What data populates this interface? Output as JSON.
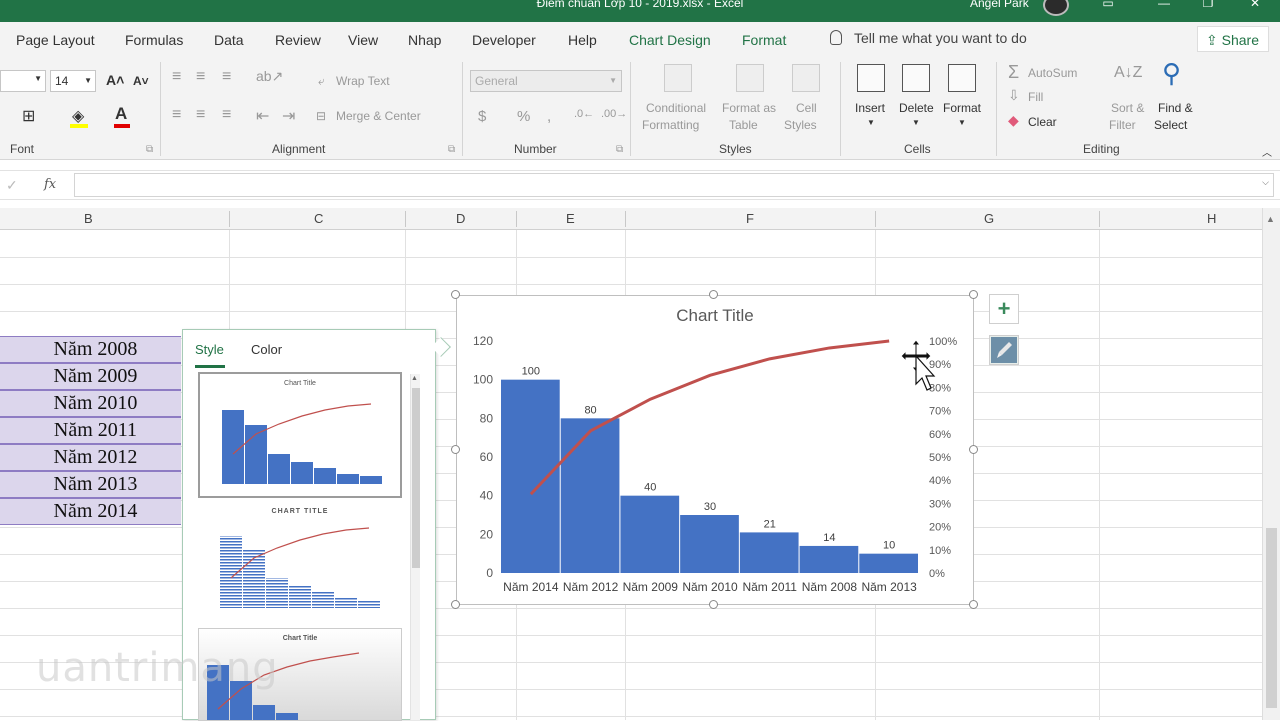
{
  "titlebar": {
    "document": "Điểm chuẩn Lớp 10 - 2019.xlsx  -  Excel",
    "user": "Angel Park"
  },
  "tabs": [
    "Page Layout",
    "Formulas",
    "Data",
    "Review",
    "View",
    "Nhap",
    "Developer",
    "Help",
    "Chart Design",
    "Format"
  ],
  "tell_me": "Tell me what you want to do",
  "share": "Share",
  "ribbon": {
    "font_size": "14",
    "groups": {
      "font": "Font",
      "alignment": "Alignment",
      "number": "Number",
      "styles": "Styles",
      "cells": "Cells",
      "editing": "Editing"
    },
    "wrap_text": "Wrap Text",
    "merge_center": "Merge & Center",
    "number_format": "General",
    "percent": "%",
    "conditional_formatting": [
      "Conditional",
      "Formatting"
    ],
    "format_as_table": [
      "Format as",
      "Table"
    ],
    "cell_styles": [
      "Cell",
      "Styles"
    ],
    "insert": "Insert",
    "delete": "Delete",
    "format": "Format",
    "autosum": "AutoSum",
    "fill": "Fill",
    "clear": "Clear",
    "sort_filter": [
      "Sort &",
      "Filter"
    ],
    "find_select": [
      "Find &",
      "Select"
    ]
  },
  "formula_bar": {
    "fx": "fx",
    "value": ""
  },
  "columns": [
    "B",
    "C",
    "D",
    "E",
    "F",
    "G",
    "H"
  ],
  "year_cells": [
    "Năm 2008",
    "Năm 2009",
    "Năm 2010",
    "Năm 2011",
    "Năm 2012",
    "Năm 2013",
    "Năm 2014"
  ],
  "style_pane": {
    "tabs": [
      "Style",
      "Color"
    ],
    "thumb_titles": [
      "Chart Title",
      "CHART TITLE",
      "Chart Title"
    ]
  },
  "chart_data": {
    "type": "bar",
    "title": "Chart Title",
    "categories": [
      "Năm 2014",
      "Năm 2012",
      "Năm 2009",
      "Năm 2010",
      "Năm 2011",
      "Năm 2008",
      "Năm 2013"
    ],
    "values": [
      100,
      80,
      40,
      30,
      21,
      14,
      10
    ],
    "cumulative_percent": [
      34.0,
      61.3,
      74.9,
      85.2,
      92.3,
      97.0,
      100.0
    ],
    "ylim": [
      0,
      120
    ],
    "yticks": [
      0,
      20,
      40,
      60,
      80,
      100,
      120
    ],
    "y2lim": [
      0,
      100
    ],
    "y2ticks": [
      "0%",
      "10%",
      "20%",
      "30%",
      "40%",
      "50%",
      "60%",
      "70%",
      "80%",
      "90%",
      "100%"
    ],
    "bar_color": "#4472c4",
    "line_color": "#c0504d"
  },
  "watermark": "uantrimang"
}
